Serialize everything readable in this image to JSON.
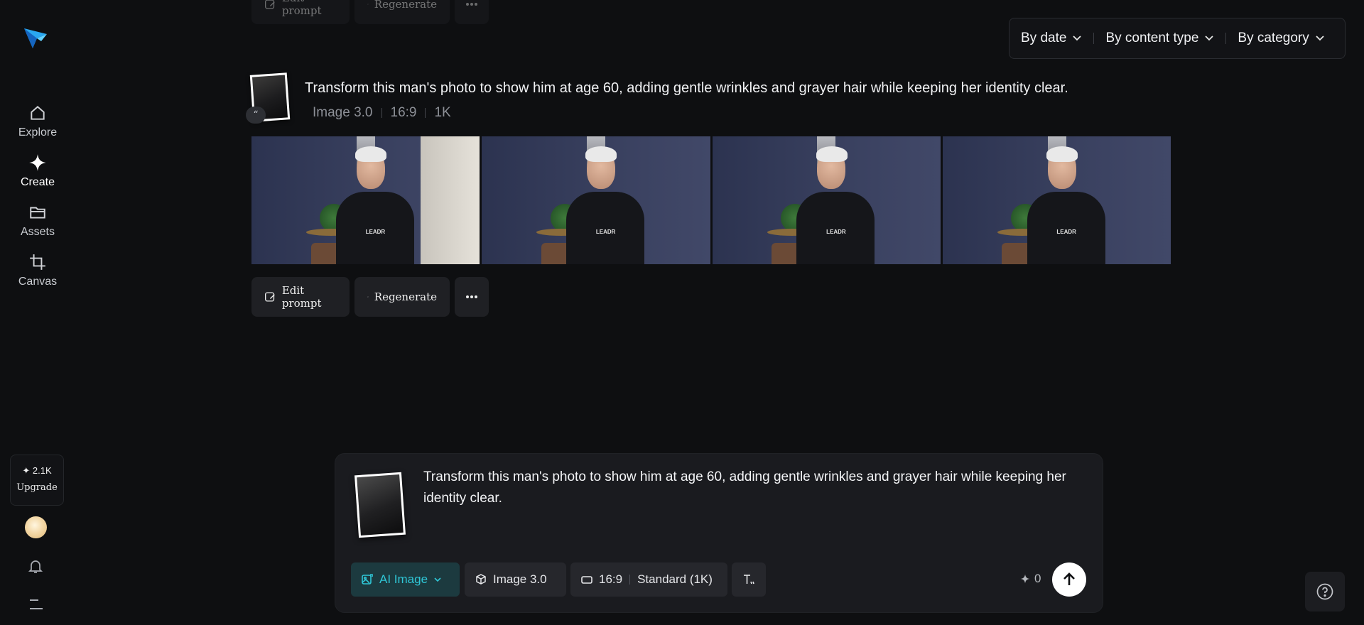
{
  "sidebar": {
    "items": [
      {
        "label": "Explore",
        "icon": "home-icon"
      },
      {
        "label": "Create",
        "icon": "sparkle-icon"
      },
      {
        "label": "Assets",
        "icon": "folder-icon"
      },
      {
        "label": "Canvas",
        "icon": "crop-icon"
      }
    ],
    "credits": "✦ 2.1K",
    "upgrade_label": "Upgrade"
  },
  "filters": [
    {
      "label": "By date"
    },
    {
      "label": "By content type"
    },
    {
      "label": "By category"
    }
  ],
  "previous_toolbar": {
    "edit_label": "Edit prompt",
    "regenerate_label": "Regenerate"
  },
  "generation": {
    "prompt": "Transform this man's photo to show him at age 60, adding gentle wrinkles and grayer hair while keeping her identity clear.",
    "model": "Image 3.0",
    "ratio": "16:9",
    "resolution": "1K",
    "quote_glyph": "“",
    "image_logo_text": "LEADR",
    "actions": {
      "edit_label": "Edit prompt",
      "regenerate_label": "Regenerate"
    }
  },
  "composer": {
    "text": "Transform this man's photo to show him at age 60, adding gentle wrinkles and grayer hair while keeping her identity clear.",
    "mode_label": "AI Image",
    "model_label": "Image 3.0",
    "ratio_label": "16:9",
    "quality_label": "Standard (1K)",
    "credit_cost": "0"
  },
  "colors": {
    "background": "#0e0f11",
    "accent": "#2fc6d6",
    "logo_blue": "#2196f3"
  }
}
